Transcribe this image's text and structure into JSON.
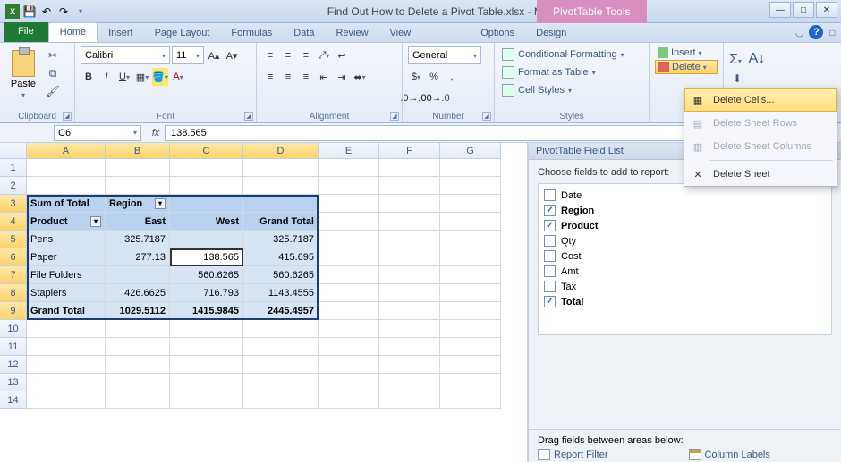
{
  "title": "Find Out How to Delete a Pivot Table.xlsx - Microsoft Excel",
  "contextual_tab": "PivotTable Tools",
  "tabs": {
    "file": "File",
    "home": "Home",
    "insert": "Insert",
    "pagelayout": "Page Layout",
    "formulas": "Formulas",
    "data": "Data",
    "review": "Review",
    "view": "View",
    "options": "Options",
    "design": "Design"
  },
  "ribbon": {
    "clipboard": {
      "label": "Clipboard",
      "paste": "Paste"
    },
    "font": {
      "label": "Font",
      "name": "Calibri",
      "size": "11"
    },
    "alignment": {
      "label": "Alignment"
    },
    "number": {
      "label": "Number",
      "format": "General"
    },
    "styles": {
      "label": "Styles",
      "cond": "Conditional Formatting",
      "fat": "Format as Table",
      "cell": "Cell Styles"
    },
    "cells": {
      "insert": "Insert",
      "delete": "Delete"
    }
  },
  "delete_menu": {
    "cells": "Delete Cells...",
    "rows": "Delete Sheet Rows",
    "cols": "Delete Sheet Columns",
    "sheet": "Delete Sheet"
  },
  "formula_bar": {
    "name": "C6",
    "value": "138.565"
  },
  "columns": [
    "A",
    "B",
    "C",
    "D",
    "E",
    "F",
    "G"
  ],
  "pivot": {
    "r3": {
      "a": "Sum of Total",
      "b": "Region"
    },
    "r4": {
      "a": "Product",
      "b": "East",
      "c": "West",
      "d": "Grand Total"
    },
    "r5": {
      "a": "Pens",
      "b": "325.7187",
      "d": "325.7187"
    },
    "r6": {
      "a": "Paper",
      "b": "277.13",
      "c": "138.565",
      "d": "415.695"
    },
    "r7": {
      "a": "File Folders",
      "c": "560.6265",
      "d": "560.6265"
    },
    "r8": {
      "a": "Staplers",
      "b": "426.6625",
      "c": "716.793",
      "d": "1143.4555"
    },
    "r9": {
      "a": "Grand Total",
      "b": "1029.5112",
      "c": "1415.9845",
      "d": "2445.4957"
    }
  },
  "fieldlist": {
    "title": "PivotTable Field List",
    "hint": "Choose fields to add to report:",
    "fields": [
      {
        "name": "Date",
        "checked": false,
        "bold": false
      },
      {
        "name": "Region",
        "checked": true,
        "bold": true
      },
      {
        "name": "Product",
        "checked": true,
        "bold": true
      },
      {
        "name": "Qty",
        "checked": false,
        "bold": false
      },
      {
        "name": "Cost",
        "checked": false,
        "bold": false
      },
      {
        "name": "Amt",
        "checked": false,
        "bold": false
      },
      {
        "name": "Tax",
        "checked": false,
        "bold": false
      },
      {
        "name": "Total",
        "checked": true,
        "bold": true
      }
    ],
    "drag_hint": "Drag fields between areas below:",
    "areas": {
      "filter": "Report Filter",
      "col": "Column Labels"
    }
  }
}
